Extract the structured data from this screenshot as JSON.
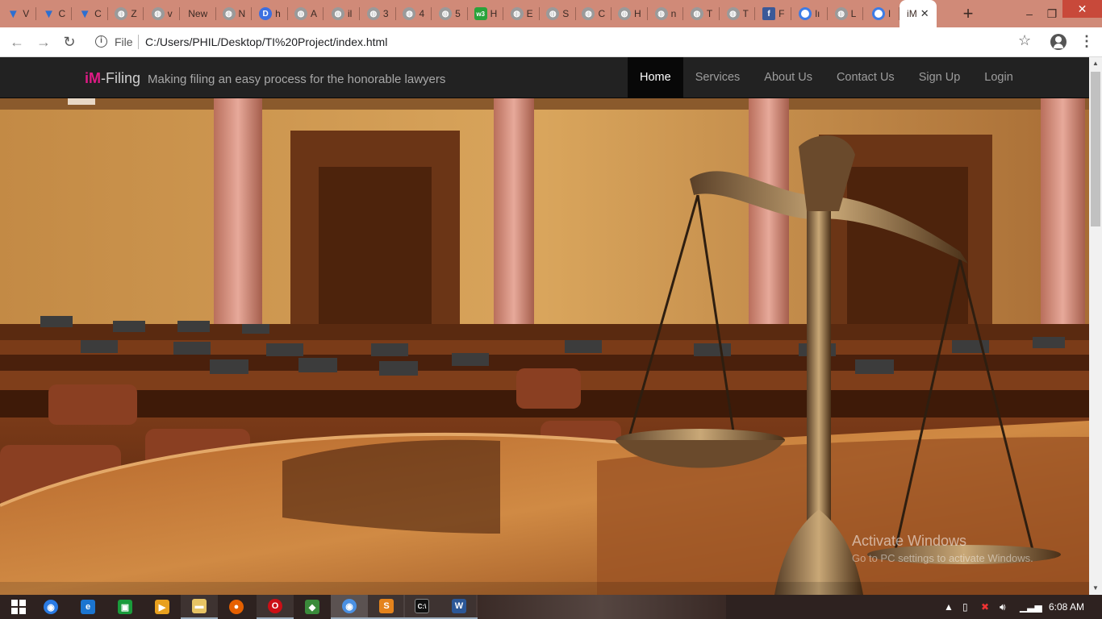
{
  "browser": {
    "tabs": [
      {
        "title": "V",
        "icon": "filter-icon",
        "fav": "filter"
      },
      {
        "title": "C",
        "icon": "filter-icon",
        "fav": "filter"
      },
      {
        "title": "C",
        "icon": "filter-icon",
        "fav": "filter"
      },
      {
        "title": "Z",
        "icon": "globe-icon",
        "fav": "grey"
      },
      {
        "title": "v",
        "icon": "globe-icon",
        "fav": "grey"
      },
      {
        "title": "New",
        "icon": "",
        "fav": "none"
      },
      {
        "title": "N",
        "icon": "globe-icon",
        "fav": "grey"
      },
      {
        "title": "h",
        "icon": "d-icon",
        "fav": "blue",
        "glyph": "D"
      },
      {
        "title": "A",
        "icon": "globe-icon",
        "fav": "grey"
      },
      {
        "title": "il",
        "icon": "globe-icon",
        "fav": "grey"
      },
      {
        "title": "3",
        "icon": "globe-icon",
        "fav": "grey"
      },
      {
        "title": "4",
        "icon": "globe-icon",
        "fav": "grey"
      },
      {
        "title": "5",
        "icon": "globe-icon",
        "fav": "grey"
      },
      {
        "title": "H",
        "icon": "w3-icon",
        "fav": "green",
        "glyph": "w3"
      },
      {
        "title": "E",
        "icon": "globe-icon",
        "fav": "grey"
      },
      {
        "title": "S",
        "icon": "globe-icon",
        "fav": "grey"
      },
      {
        "title": "C",
        "icon": "globe-icon",
        "fav": "grey"
      },
      {
        "title": "H",
        "icon": "globe-icon",
        "fav": "grey"
      },
      {
        "title": "n",
        "icon": "globe-icon",
        "fav": "grey"
      },
      {
        "title": "T",
        "icon": "globe-icon",
        "fav": "grey"
      },
      {
        "title": "T",
        "icon": "globe-icon",
        "fav": "grey"
      },
      {
        "title": "F",
        "icon": "facebook-icon",
        "fav": "fb",
        "glyph": "f"
      },
      {
        "title": "lı",
        "icon": "ring-icon",
        "fav": "ring"
      },
      {
        "title": "L",
        "icon": "globe-icon",
        "fav": "grey"
      },
      {
        "title": "I",
        "icon": "ring-icon",
        "fav": "ring"
      },
      {
        "title": "iM",
        "icon": "",
        "fav": "none",
        "active": true
      }
    ],
    "file_label": "File",
    "url": "C:/Users/PHIL/Desktop/TI%20Project/index.html"
  },
  "site": {
    "brand_im": "iM",
    "brand_filing": "-Filing",
    "tagline": "Making filing an easy process for the honorable lawyers",
    "nav": [
      "Home",
      "Services",
      "About Us",
      "Contact Us",
      "Sign Up",
      "Login"
    ],
    "active_nav": "Home"
  },
  "watermark": {
    "title": "Activate Windows",
    "subtitle": "Go to PC settings to activate Windows."
  },
  "taskbar": {
    "clock": "6:08 AM"
  },
  "colors": {
    "brand_pink": "#e01a86",
    "navbar_bg": "#222222",
    "tabstrip": "#d08a78"
  }
}
